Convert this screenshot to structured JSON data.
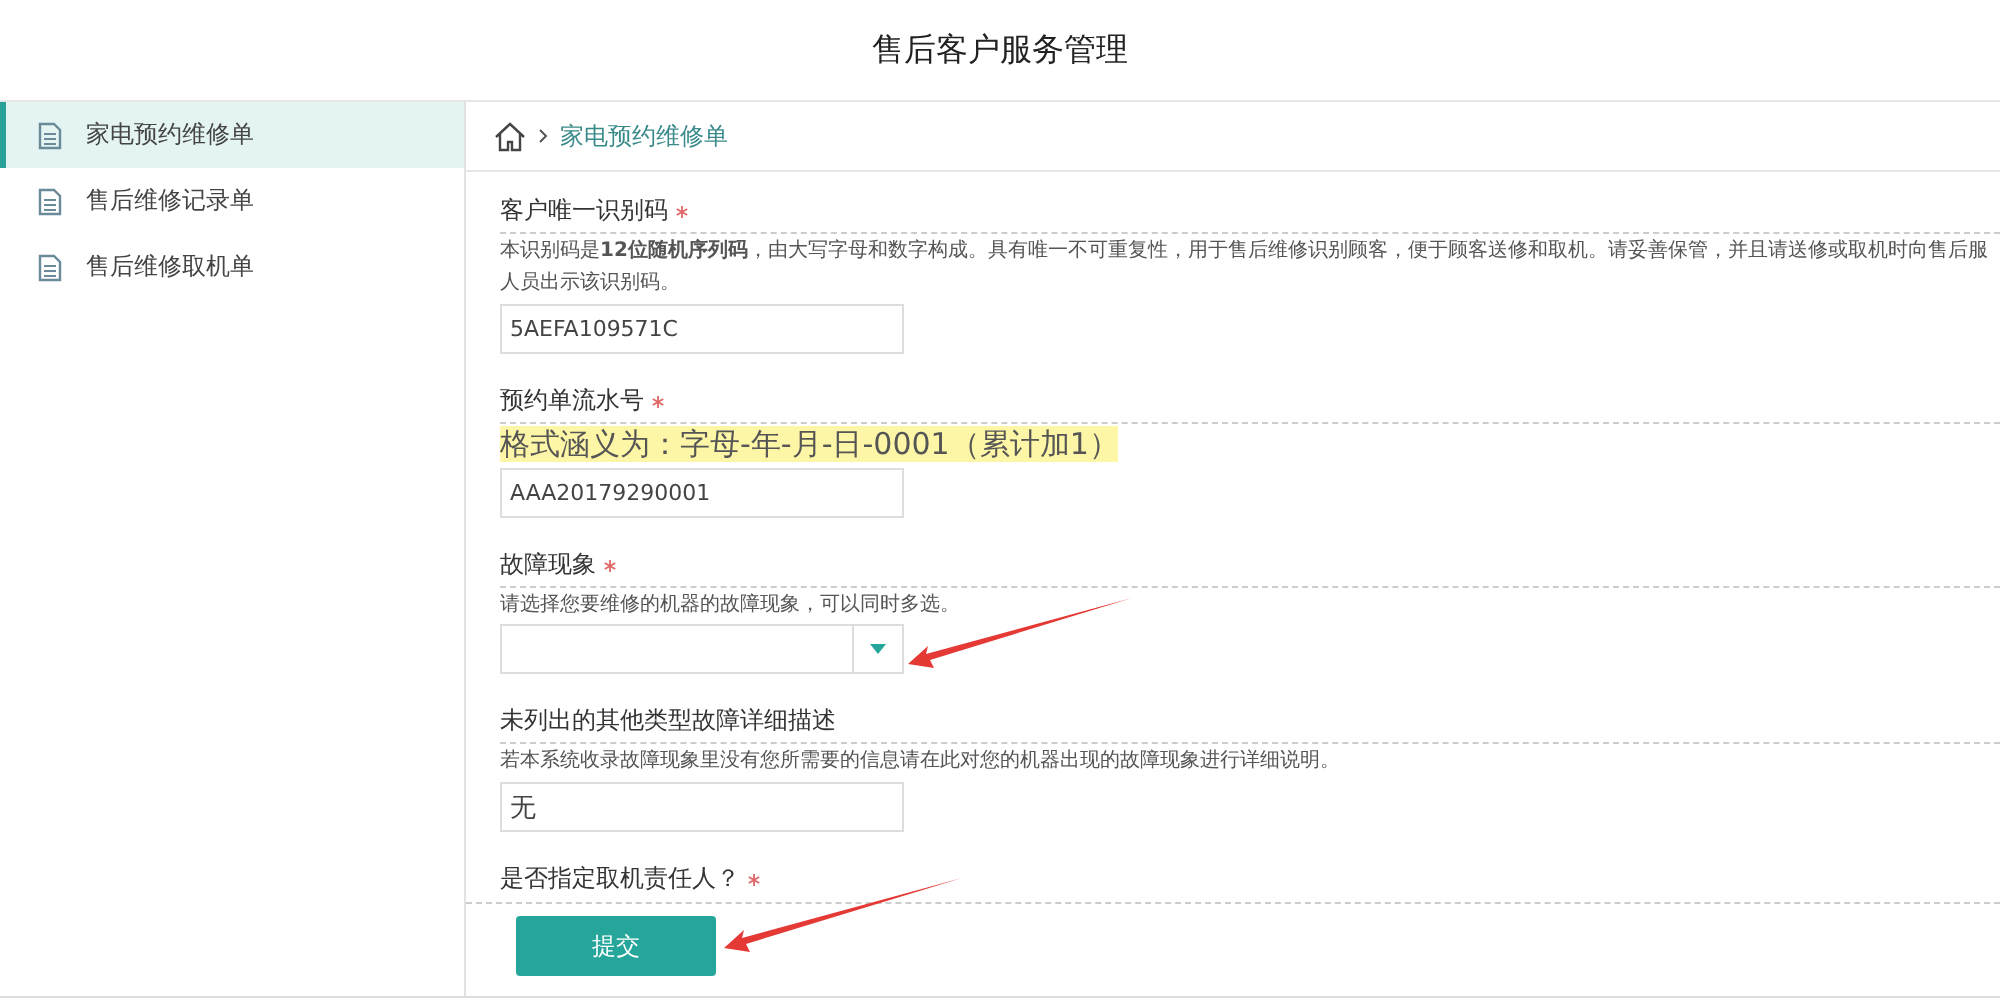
{
  "header": {
    "title": "售后客户服务管理"
  },
  "sidebar": {
    "items": [
      {
        "label": "家电预约维修单",
        "selected": true
      },
      {
        "label": "售后维修记录单",
        "selected": false
      },
      {
        "label": "售后维修取机单",
        "selected": false
      }
    ]
  },
  "breadcrumb": {
    "current": "家电预约维修单"
  },
  "form": {
    "fields": [
      {
        "kind": "text",
        "label": "客户唯一识别码",
        "required": true,
        "help": [
          "本识别码是**12位随机序列码**，由大写字母和数字构成。具有唯一不可重复性，用于售后维修识别顾客，便于顾客送修和取机。请妥善保管，并且请送修或取机时向售后服",
          "人员出示该识别码。"
        ],
        "value": "5AEFA109571C"
      },
      {
        "kind": "text",
        "label": "预约单流水号",
        "required": true,
        "note": "格式涵义为：字母-年-月-日-0001（累计加1）",
        "value": "AAA20179290001"
      },
      {
        "kind": "select",
        "label": "故障现象",
        "required": true,
        "help": [
          "请选择您要维修的机器的故障现象，可以同时多选。"
        ]
      },
      {
        "kind": "text",
        "label": "未列出的其他类型故障详细描述",
        "required": false,
        "help": [
          "若本系统收录故障现象里没有您所需要的信息请在此对您的机器出现的故障现象进行详细说明。"
        ],
        "value": "无"
      },
      {
        "kind": "label",
        "label": "是否指定取机责任人？",
        "required": true
      }
    ],
    "submit": "提交"
  }
}
